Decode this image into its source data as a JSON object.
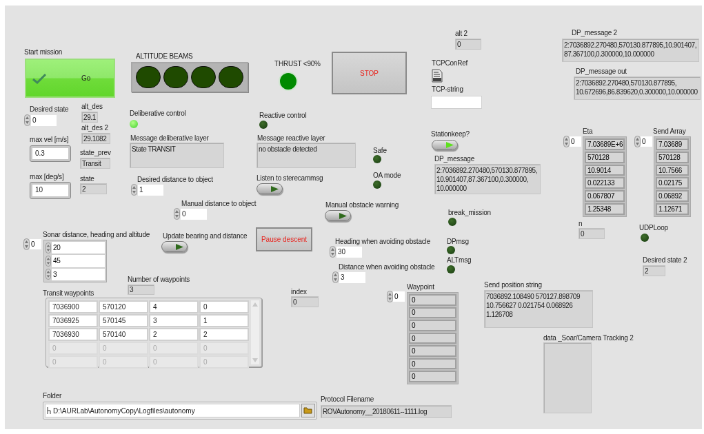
{
  "controls": [
    {
      "kind": "ok_button",
      "label": "Start mission",
      "text": "Go"
    },
    {
      "kind": "led_array",
      "label": "ALTITUDE BEAMS",
      "leds": [
        {
          "on": false
        },
        {
          "on": false
        },
        {
          "on": false
        },
        {
          "on": false
        }
      ]
    },
    {
      "kind": "led",
      "label": "THRUST <90%",
      "on": true
    },
    {
      "kind": "button",
      "text": "STOP"
    },
    {
      "kind": "indicator",
      "label": "alt 2",
      "value": "0"
    },
    {
      "kind": "refnum",
      "label": "TCPConRef"
    },
    {
      "kind": "string_control",
      "label": "TCP-string"
    },
    {
      "kind": "string_indicator",
      "label": "DP_message 2",
      "lines": [
        "2:7036892.270480,570130.877895,10.901407,",
        "87.367100,0.300000,10.000000"
      ]
    },
    {
      "kind": "string_indicator",
      "label": "DP_message out",
      "lines": [
        "2:7036892.270480,570130.877895,",
        "10.672696,86.839620,0.300000,10.000000"
      ]
    },
    {
      "kind": "numeric_control",
      "label": "Desired state",
      "value": "0"
    },
    {
      "kind": "indicator",
      "label": "alt_des",
      "value": "29.1"
    },
    {
      "kind": "indicator",
      "label": "alt_des 2",
      "value": "29.1082"
    },
    {
      "kind": "numeric_box",
      "label": "max vel [m/s]",
      "value": "0.3"
    },
    {
      "kind": "indicator",
      "label": "state_prev",
      "value": "Transit"
    },
    {
      "kind": "numeric_box",
      "label": "max [deg/s]",
      "value": "10"
    },
    {
      "kind": "indicator",
      "label": "state",
      "value": "2"
    },
    {
      "kind": "led",
      "label": "Deliberative control",
      "on": true
    },
    {
      "kind": "string_indicator",
      "label": "Message deliberative layer",
      "lines": [
        "State TRANSIT"
      ]
    },
    {
      "kind": "numeric_control",
      "label": "Desired distance to object",
      "value": "1"
    },
    {
      "kind": "numeric_control",
      "label": "Manual distance to object",
      "value": "0"
    },
    {
      "kind": "led",
      "label": "Reactive control",
      "on": false
    },
    {
      "kind": "string_indicator",
      "label": "Message reactive layer",
      "lines": [
        "no obstacle detected"
      ]
    },
    {
      "kind": "led",
      "label": "Safe",
      "on": false
    },
    {
      "kind": "led",
      "label": "OA mode",
      "on": false
    },
    {
      "kind": "toggle",
      "label": "Listen to sterecammsg",
      "on": false
    },
    {
      "kind": "toggle",
      "label": "Stationkeep?",
      "on": true
    },
    {
      "kind": "string_indicator",
      "label": "DP_message",
      "lines": [
        "2:7036892.270480,570130.877895,",
        "10.901407,87.367100,0.300000,",
        "10.000000"
      ]
    },
    {
      "kind": "toggle",
      "label": "Manual obstacle warning",
      "on": false
    },
    {
      "kind": "led",
      "label": "break_mission",
      "on": false
    },
    {
      "kind": "array",
      "label": "Eta",
      "index": "0",
      "editable": false,
      "items": [
        "7.03689E+6",
        "570128",
        "10.9014",
        "0.022133",
        "0.067807",
        "1.25348"
      ]
    },
    {
      "kind": "array",
      "label": "Send Array",
      "index": "0",
      "editable": false,
      "items": [
        "7.03689",
        "570128",
        "10.7566",
        "0.02175",
        "0.06892",
        "1.12671"
      ]
    },
    {
      "kind": "indicator",
      "label": "n",
      "value": "0"
    },
    {
      "kind": "led",
      "label": "UDPLoop",
      "on": false
    },
    {
      "kind": "array",
      "label": "Sonar distance, heading and altitude",
      "index": "0",
      "editable": true,
      "items": [
        "20",
        "45",
        "3"
      ]
    },
    {
      "kind": "toggle",
      "label": "Update bearing and distance",
      "on": false
    },
    {
      "kind": "button",
      "text": "Pause descent"
    },
    {
      "kind": "numeric_control",
      "label": "Heading when avoiding obstacle",
      "value": "30"
    },
    {
      "kind": "led",
      "label": "DPmsg",
      "on": false
    },
    {
      "kind": "numeric_control",
      "label": "Distance when avoiding obstacle",
      "value": "3"
    },
    {
      "kind": "led",
      "label": "ALTmsg",
      "on": false
    },
    {
      "kind": "indicator",
      "label": "Desired state 2",
      "value": "2"
    },
    {
      "kind": "indicator",
      "label": "Number of waypoints",
      "value": "3"
    },
    {
      "kind": "table",
      "label": "Transit waypoints",
      "rows": [
        {
          "cells": [
            "7036900",
            "570120",
            "4",
            "0"
          ],
          "disabled": false
        },
        {
          "cells": [
            "7036925",
            "570145",
            "3",
            "1"
          ],
          "disabled": false
        },
        {
          "cells": [
            "7036930",
            "570140",
            "2",
            "2"
          ],
          "disabled": false
        },
        {
          "cells": [
            "0",
            "0",
            "0",
            "0"
          ],
          "disabled": true
        },
        {
          "cells": [
            "0",
            "0",
            "0",
            "0"
          ],
          "disabled": true
        }
      ]
    },
    {
      "kind": "indicator",
      "label": "index",
      "value": "0"
    },
    {
      "kind": "array",
      "label": "Waypoint",
      "index": "0",
      "editable": false,
      "items": [
        "0",
        "0",
        "0",
        "0",
        "0",
        "0",
        "0"
      ]
    },
    {
      "kind": "string_indicator",
      "label": "Send position string",
      "lines": [
        "7036892.108490 570127.898709",
        "10.756627 0.021754 0.068926",
        "1.126708"
      ]
    },
    {
      "kind": "string_indicator",
      "label": "data _Soar/Camera Tracking 2"
    },
    {
      "kind": "path",
      "label": "Folder",
      "value": "D:\\AURLab\\AutonomyCopy\\Logfiles\\autonomy"
    },
    {
      "kind": "indicator",
      "label": "Protocol Filename",
      "value": "ROVAutonomy__20180611--1111.log"
    }
  ]
}
